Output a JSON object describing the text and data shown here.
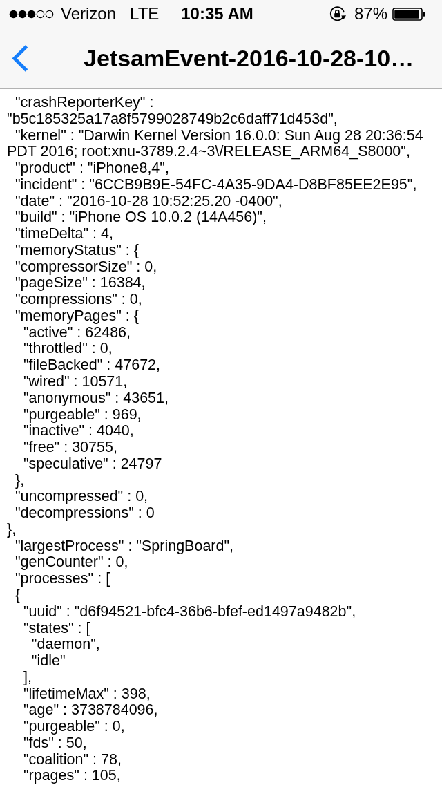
{
  "status_bar": {
    "carrier": "Verizon",
    "network": "LTE",
    "time": "10:35 AM",
    "battery": "87%"
  },
  "nav_bar": {
    "title": "JetsamEvent-2016-10-28-10…"
  },
  "document": {
    "lines": [
      "  \"crashReporterKey\" :",
      "\"b5c185325a17a8f5799028749b2c6daff71d453d\",",
      "  \"kernel\" : \"Darwin Kernel Version 16.0.0: Sun Aug 28 20:36:54",
      "PDT 2016; root:xnu-3789.2.4~3\\/RELEASE_ARM64_S8000\",",
      "  \"product\" : \"iPhone8,4\",",
      "  \"incident\" : \"6CCB9B9E-54FC-4A35-9DA4-D8BF85EE2E95\",",
      "  \"date\" : \"2016-10-28 10:52:25.20 -0400\",",
      "  \"build\" : \"iPhone OS 10.0.2 (14A456)\",",
      "  \"timeDelta\" : 4,",
      "  \"memoryStatus\" : {",
      "  \"compressorSize\" : 0,",
      "  \"pageSize\" : 16384,",
      "  \"compressions\" : 0,",
      "  \"memoryPages\" : {",
      "    \"active\" : 62486,",
      "    \"throttled\" : 0,",
      "    \"fileBacked\" : 47672,",
      "    \"wired\" : 10571,",
      "    \"anonymous\" : 43651,",
      "    \"purgeable\" : 969,",
      "    \"inactive\" : 4040,",
      "    \"free\" : 30755,",
      "    \"speculative\" : 24797",
      "  },",
      "  \"uncompressed\" : 0,",
      "  \"decompressions\" : 0",
      "},",
      "  \"largestProcess\" : \"SpringBoard\",",
      "  \"genCounter\" : 0,",
      "  \"processes\" : [",
      "  {",
      "    \"uuid\" : \"d6f94521-bfc4-36b6-bfef-ed1497a9482b\",",
      "    \"states\" : [",
      "      \"daemon\",",
      "      \"idle\"",
      "    ],",
      "    \"lifetimeMax\" : 398,",
      "    \"age\" : 3738784096,",
      "    \"purgeable\" : 0,",
      "    \"fds\" : 50,",
      "    \"coalition\" : 78,",
      "    \"rpages\" : 105,"
    ]
  }
}
